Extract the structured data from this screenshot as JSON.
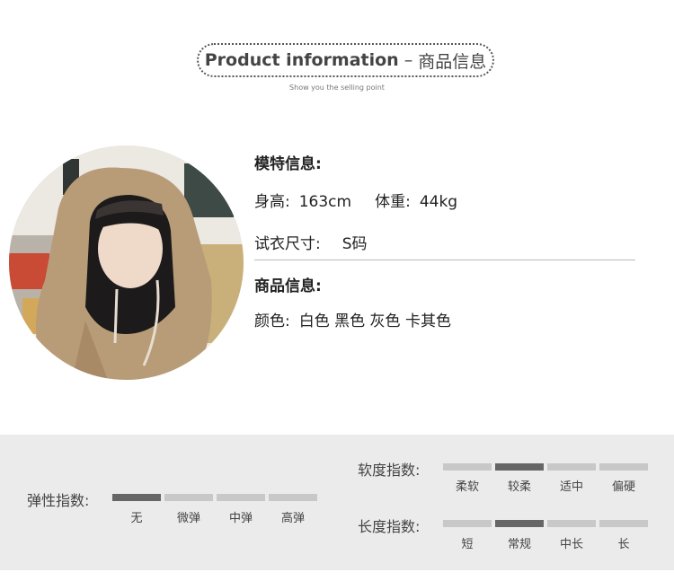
{
  "header": {
    "title_en": "Product information",
    "dash": "–",
    "title_cn": "商品信息",
    "subtitle": "Show you the selling point"
  },
  "model": {
    "section_title": "模特信息:",
    "height_label": "身高:",
    "height_value": "163cm",
    "weight_label": "体重:",
    "weight_value": "44kg",
    "size_label": "试衣尺寸:",
    "size_value": "S码"
  },
  "product": {
    "section_title": "商品信息:",
    "color_label": "颜色:",
    "color_values": "白色 黑色 灰色 卡其色"
  },
  "metrics": {
    "elasticity": {
      "label": "弹性指数:",
      "options": [
        "无",
        "微弹",
        "中弹",
        "高弹"
      ],
      "selected": 0
    },
    "softness": {
      "label": "软度指数:",
      "options": [
        "柔软",
        "较柔",
        "适中",
        "偏硬"
      ],
      "selected": 1
    },
    "length": {
      "label": "长度指数:",
      "options": [
        "短",
        "常规",
        "中长",
        "长"
      ],
      "selected": 1
    }
  },
  "colors": {
    "active_bar": "#666666",
    "inactive_bar": "#c8c8c8",
    "panel_bg": "#ebebeb"
  }
}
